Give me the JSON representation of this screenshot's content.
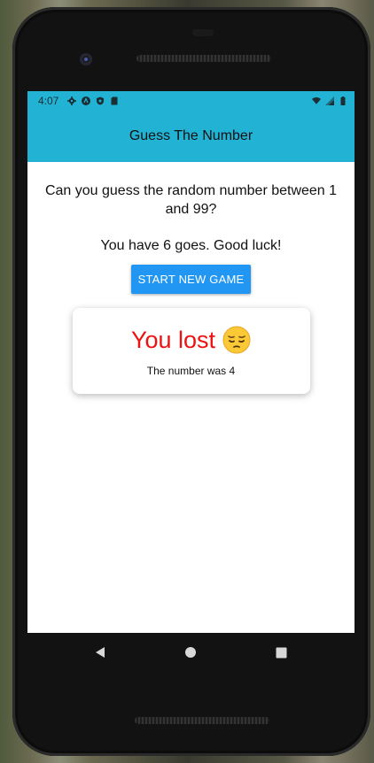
{
  "status": {
    "time": "4:07",
    "left_icons": [
      "gear-icon",
      "android-icon",
      "shield-icon",
      "sdcard-icon"
    ],
    "right_icons": [
      "wifi-icon",
      "signal-icon",
      "battery-icon"
    ]
  },
  "app": {
    "title": "Guess The Number"
  },
  "main": {
    "question": "Can you guess the random number between 1 and 99?",
    "goes": "You have 6 goes. Good luck!",
    "start_button": "START NEW GAME"
  },
  "result_card": {
    "title": "You lost",
    "emoji": "pensive-face-icon",
    "message": "The number was 4",
    "title_color": "#ee1111"
  },
  "nav": {
    "back": "back-icon",
    "home": "home-icon",
    "recents": "recents-icon"
  },
  "colors": {
    "accent": "#22b2d4",
    "button": "#2196f3"
  }
}
